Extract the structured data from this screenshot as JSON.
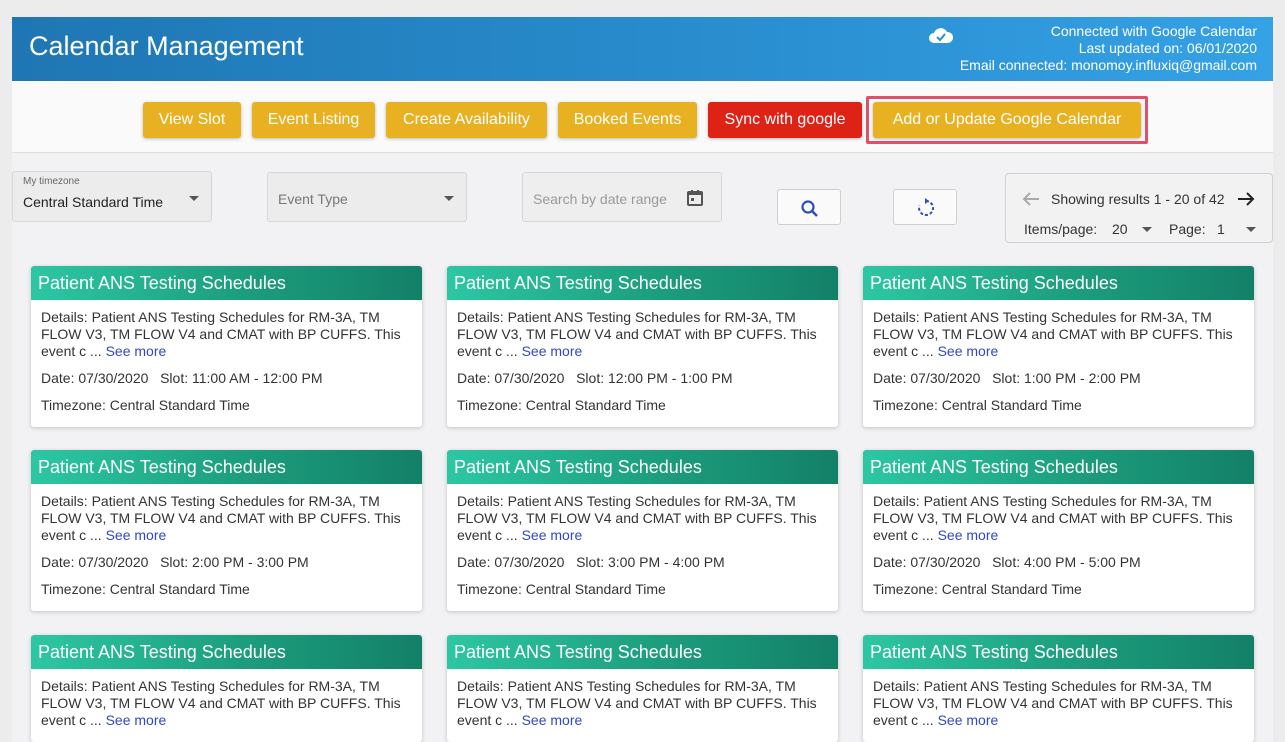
{
  "header": {
    "title": "Calendar Management",
    "status_line1": "Connected with Google Calendar",
    "status_line2": "Last updated on: 06/01/2020",
    "status_line3": "Email connected: monomoy.influxiq@gmail.com",
    "cloud_icon": "cloud-check-icon"
  },
  "toolbar": {
    "view_slot": "View Slot",
    "event_listing": "Event Listing",
    "create_availability": "Create Availability",
    "booked_events": "Booked Events",
    "sync_google": "Sync with google",
    "add_update_google": "Add or Update Google Calendar"
  },
  "filters": {
    "timezone_label": "My timezone",
    "timezone_value": "Central Standard Time",
    "event_type_placeholder": "Event Type",
    "date_range_placeholder": "Search by date range",
    "search_icon": "search-icon",
    "refresh_icon": "refresh-icon"
  },
  "pagination": {
    "showing": "Showing results 1 - 20 of 42",
    "items_per_page_label": "Items/page:",
    "items_per_page_value": "20",
    "page_label": "Page:",
    "page_value": "1"
  },
  "colors": {
    "header_blue": "#2a8fd0",
    "button_gold": "#e8b122",
    "button_red": "#de2216",
    "card_header_teal": "#1c9d7c",
    "link_blue": "#3047c6",
    "highlight_pink": "#e0506a"
  },
  "cards": [
    {
      "title": "Patient ANS Testing Schedules",
      "details": "Details: Patient ANS Testing Schedules for RM-3A, TM FLOW V3, TM FLOW V4 and CMAT with BP CUFFS. This event c ...",
      "see_more": "See more",
      "date": "Date: 07/30/2020",
      "slot": "Slot: 11:00 AM - 12:00 PM",
      "timezone": "Timezone: Central Standard Time"
    },
    {
      "title": "Patient ANS Testing Schedules",
      "details": "Details: Patient ANS Testing Schedules for RM-3A, TM FLOW V3, TM FLOW V4 and CMAT with BP CUFFS. This event c ...",
      "see_more": "See more",
      "date": "Date: 07/30/2020",
      "slot": "Slot: 12:00 PM - 1:00 PM",
      "timezone": "Timezone: Central Standard Time"
    },
    {
      "title": "Patient ANS Testing Schedules",
      "details": "Details: Patient ANS Testing Schedules for RM-3A, TM FLOW V3, TM FLOW V4 and CMAT with BP CUFFS. This event c ...",
      "see_more": "See more",
      "date": "Date: 07/30/2020",
      "slot": "Slot: 1:00 PM - 2:00 PM",
      "timezone": "Timezone: Central Standard Time"
    },
    {
      "title": "Patient ANS Testing Schedules",
      "details": "Details: Patient ANS Testing Schedules for RM-3A, TM FLOW V3, TM FLOW V4 and CMAT with BP CUFFS. This event c ...",
      "see_more": "See more",
      "date": "Date: 07/30/2020",
      "slot": "Slot: 2:00 PM - 3:00 PM",
      "timezone": "Timezone: Central Standard Time"
    },
    {
      "title": "Patient ANS Testing Schedules",
      "details": "Details: Patient ANS Testing Schedules for RM-3A, TM FLOW V3, TM FLOW V4 and CMAT with BP CUFFS. This event c ...",
      "see_more": "See more",
      "date": "Date: 07/30/2020",
      "slot": "Slot: 3:00 PM - 4:00 PM",
      "timezone": "Timezone: Central Standard Time"
    },
    {
      "title": "Patient ANS Testing Schedules",
      "details": "Details: Patient ANS Testing Schedules for RM-3A, TM FLOW V3, TM FLOW V4 and CMAT with BP CUFFS. This event c ...",
      "see_more": "See more",
      "date": "Date: 07/30/2020",
      "slot": "Slot: 4:00 PM - 5:00 PM",
      "timezone": "Timezone: Central Standard Time"
    },
    {
      "title": "Patient ANS Testing Schedules",
      "details": "Details: Patient ANS Testing Schedules for RM-3A, TM FLOW V3, TM FLOW V4 and CMAT with BP CUFFS. This event c ...",
      "see_more": "See more"
    },
    {
      "title": "Patient ANS Testing Schedules",
      "details": "Details: Patient ANS Testing Schedules for RM-3A, TM FLOW V3, TM FLOW V4 and CMAT with BP CUFFS. This event c ...",
      "see_more": "See more"
    },
    {
      "title": "Patient ANS Testing Schedules",
      "details": "Details: Patient ANS Testing Schedules for RM-3A, TM FLOW V3, TM FLOW V4 and CMAT with BP CUFFS. This event c ...",
      "see_more": "See more"
    }
  ]
}
